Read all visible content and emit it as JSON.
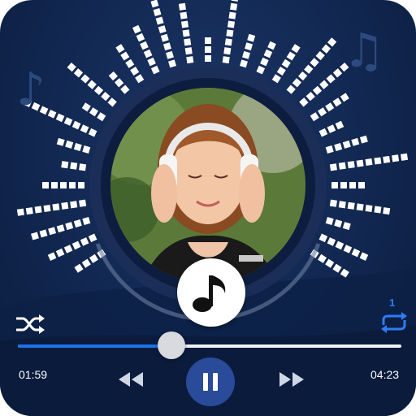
{
  "player": {
    "elapsed": "01:59",
    "duration": "04:23",
    "progress": 0.4,
    "repeat_count": "1",
    "state": "playing"
  },
  "icons": {
    "shuffle": "shuffle-icon",
    "repeat": "repeat-icon",
    "previous": "rewind-icon",
    "next": "fast-forward-icon",
    "pause": "pause-icon",
    "note": "music-note-icon"
  },
  "colors": {
    "background": "#132a55",
    "accent": "#1a73e8",
    "repeat": "#2e7cf6",
    "play_button": "#2a4b9a"
  }
}
